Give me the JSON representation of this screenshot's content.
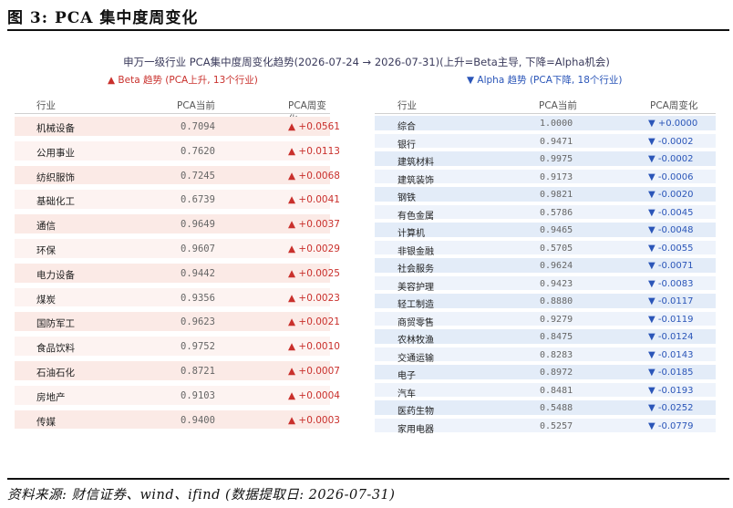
{
  "figure_title": "图 3: PCA 集中度周变化",
  "chart_title": "申万一级行业 PCA集中度周变化趋势(2026-07-24 → 2026-07-31)(上升=Beta主导, 下降=Alpha机会)",
  "legend_up": "▲ Beta 趋势 (PCA上升, 13个行业)",
  "legend_down": "▼ Alpha 趋势 (PCA下降, 18个行业)",
  "headers": {
    "industry": "行业",
    "pca": "PCA当前",
    "change": "PCA周变化"
  },
  "colors": {
    "up": "#c9302c",
    "down": "#2a55b8"
  },
  "up_rows": [
    {
      "name": "机械设备",
      "pca": "0.7094",
      "change": "▲ +0.0561"
    },
    {
      "name": "公用事业",
      "pca": "0.7620",
      "change": "▲ +0.0113"
    },
    {
      "name": "纺织服饰",
      "pca": "0.7245",
      "change": "▲ +0.0068"
    },
    {
      "name": "基础化工",
      "pca": "0.6739",
      "change": "▲ +0.0041"
    },
    {
      "name": "通信",
      "pca": "0.9649",
      "change": "▲ +0.0037"
    },
    {
      "name": "环保",
      "pca": "0.9607",
      "change": "▲ +0.0029"
    },
    {
      "name": "电力设备",
      "pca": "0.9442",
      "change": "▲ +0.0025"
    },
    {
      "name": "煤炭",
      "pca": "0.9356",
      "change": "▲ +0.0023"
    },
    {
      "name": "国防军工",
      "pca": "0.9623",
      "change": "▲ +0.0021"
    },
    {
      "name": "食品饮料",
      "pca": "0.9752",
      "change": "▲ +0.0010"
    },
    {
      "name": "石油石化",
      "pca": "0.8721",
      "change": "▲ +0.0007"
    },
    {
      "name": "房地产",
      "pca": "0.9103",
      "change": "▲ +0.0004"
    },
    {
      "name": "传媒",
      "pca": "0.9400",
      "change": "▲ +0.0003"
    }
  ],
  "down_rows": [
    {
      "name": "综合",
      "pca": "1.0000",
      "change": "▼ +0.0000"
    },
    {
      "name": "银行",
      "pca": "0.9471",
      "change": "▼ -0.0002"
    },
    {
      "name": "建筑材料",
      "pca": "0.9975",
      "change": "▼ -0.0002"
    },
    {
      "name": "建筑装饰",
      "pca": "0.9173",
      "change": "▼ -0.0006"
    },
    {
      "name": "钢铁",
      "pca": "0.9821",
      "change": "▼ -0.0020"
    },
    {
      "name": "有色金属",
      "pca": "0.5786",
      "change": "▼ -0.0045"
    },
    {
      "name": "计算机",
      "pca": "0.9465",
      "change": "▼ -0.0048"
    },
    {
      "name": "非银金融",
      "pca": "0.5705",
      "change": "▼ -0.0055"
    },
    {
      "name": "社会服务",
      "pca": "0.9624",
      "change": "▼ -0.0071"
    },
    {
      "name": "美容护理",
      "pca": "0.9423",
      "change": "▼ -0.0083"
    },
    {
      "name": "轻工制造",
      "pca": "0.8880",
      "change": "▼ -0.0117"
    },
    {
      "name": "商贸零售",
      "pca": "0.9279",
      "change": "▼ -0.0119"
    },
    {
      "name": "农林牧渔",
      "pca": "0.8475",
      "change": "▼ -0.0124"
    },
    {
      "name": "交通运输",
      "pca": "0.8283",
      "change": "▼ -0.0143"
    },
    {
      "name": "电子",
      "pca": "0.8972",
      "change": "▼ -0.0185"
    },
    {
      "name": "汽车",
      "pca": "0.8481",
      "change": "▼ -0.0193"
    },
    {
      "name": "医药生物",
      "pca": "0.5488",
      "change": "▼ -0.0252"
    },
    {
      "name": "家用电器",
      "pca": "0.5257",
      "change": "▼ -0.0779"
    }
  ],
  "source": "资料来源: 财信证券、wind、ifind (数据提取日: 2026-07-31)"
}
